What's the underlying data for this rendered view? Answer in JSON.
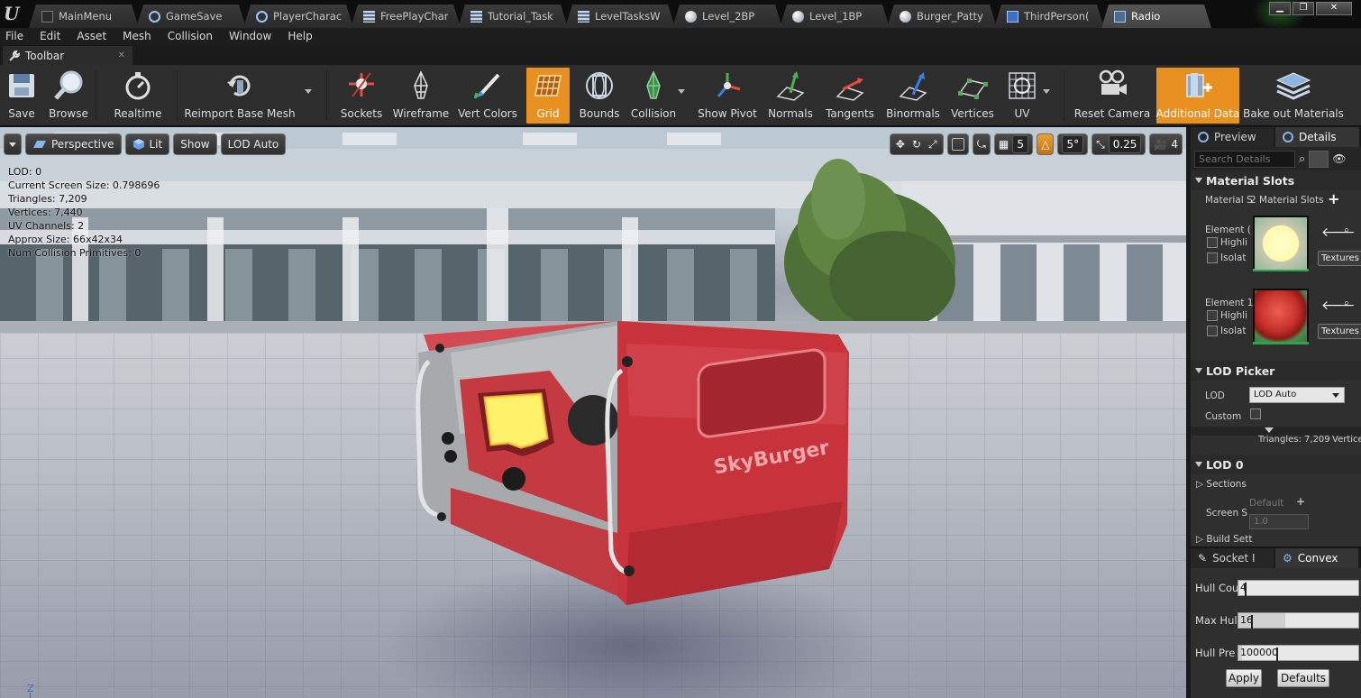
{
  "app": {
    "logo": "U"
  },
  "tabs": [
    {
      "label": "MainMenu",
      "icon": "level-icon"
    },
    {
      "label": "GameSave",
      "icon": "struct-icon"
    },
    {
      "label": "PlayerCharac",
      "icon": "struct-icon"
    },
    {
      "label": "FreePlayChar",
      "icon": "table-icon"
    },
    {
      "label": "Tutorial_Task",
      "icon": "table-icon"
    },
    {
      "label": "LevelTasksW",
      "icon": "table-icon"
    },
    {
      "label": "Level_2BP",
      "icon": "blueprint-sphere-icon"
    },
    {
      "label": "Level_1BP",
      "icon": "blueprint-sphere-icon"
    },
    {
      "label": "Burger_Patty",
      "icon": "blueprint-sphere-icon"
    },
    {
      "label": "ThirdPerson(",
      "icon": "blueprint-icon"
    },
    {
      "label": "Radio",
      "icon": "static-mesh-icon"
    }
  ],
  "menu": [
    "File",
    "Edit",
    "Asset",
    "Mesh",
    "Collision",
    "Window",
    "Help"
  ],
  "toolbar_tab": {
    "label": "Toolbar"
  },
  "toolbar": {
    "save": "Save",
    "browse": "Browse",
    "realtime": "Realtime",
    "reimport": "Reimport Base Mesh",
    "sockets": "Sockets",
    "wireframe": "Wireframe",
    "vert_colors": "Vert Colors",
    "grid": "Grid",
    "bounds": "Bounds",
    "collision": "Collision",
    "show_pivot": "Show Pivot",
    "normals": "Normals",
    "tangents": "Tangents",
    "binormals": "Binormals",
    "vertices": "Vertices",
    "uv": "UV",
    "reset_camera": "Reset Camera",
    "additional_data": "Additional Data",
    "bake_out": "Bake out Materials"
  },
  "viewport": {
    "perspective": "Perspective",
    "lit": "Lit",
    "show": "Show",
    "lod": "LOD Auto",
    "grid_snap": "5",
    "rot_snap": "5°",
    "scale_snap": "0.25",
    "cam_speed": "4",
    "stats": [
      "LOD:  0",
      "Current Screen Size:  0.798696",
      "Triangles:  7,209",
      "Vertices:  7,440",
      "UV Channels:  2",
      "Approx Size: 66x42x34",
      "Num Collision Primitives:  0"
    ],
    "axis": "Z",
    "mesh_sign": "SkyBurger"
  },
  "details": {
    "tab_preview": "Preview",
    "tab_details": "Details",
    "search_placeholder": "Search Details",
    "material_slots": {
      "title": "Material Slots",
      "label": "Material S",
      "value": "2 Material Slots",
      "element0": "Element (",
      "element1": "Element 1",
      "highlight": "Highli",
      "isolate": "Isolat",
      "textures": "Textures"
    },
    "lod_picker": {
      "title": "LOD Picker",
      "lod_label": "LOD",
      "lod_value": "LOD Auto",
      "custom_label": "Custom"
    },
    "lod0": {
      "title": "LOD 0",
      "triangles": "Triangles: 7,209",
      "vertices": "Vertice",
      "sections": "Sections",
      "screen_size_label": "Screen S",
      "default_label": "Default",
      "screen_size_value": "1.0",
      "build_settings": "Build Sett"
    }
  },
  "convex": {
    "tab_socket": "Socket I",
    "tab_convex": "Convex",
    "hull_count_label": "Hull Cou",
    "hull_count": "4",
    "max_hull_label": "Max Hul",
    "max_hull": "16",
    "hull_precision_label": "Hull Pre",
    "hull_precision": "100000",
    "apply": "Apply",
    "defaults": "Defaults"
  },
  "colors": {
    "accent": "#e89020",
    "panel": "#2f2f2f",
    "mesh_red": "#c8353a"
  }
}
